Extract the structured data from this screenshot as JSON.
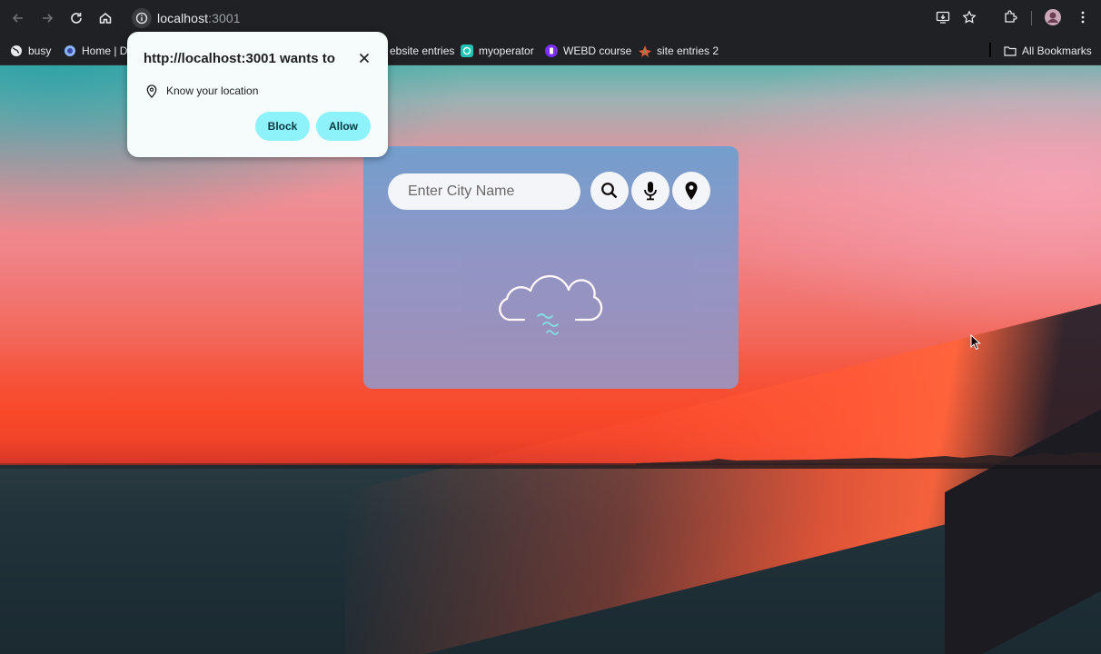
{
  "browser": {
    "url_host": "localhost",
    "url_port": ":3001",
    "bookmarks": [
      {
        "label": "busy",
        "icon": "globe-icon"
      },
      {
        "label": "Home | DD",
        "icon": "site-icon"
      },
      {
        "label": "ebsite entries",
        "icon": ""
      },
      {
        "label": "myoperator",
        "icon": "myoperator-icon"
      },
      {
        "label": "WEBD course",
        "icon": "webd-icon"
      },
      {
        "label": "site entries 2",
        "icon": "site-entries-icon"
      }
    ],
    "all_bookmarks_label": "All Bookmarks"
  },
  "permission_prompt": {
    "title": "http://localhost:3001 wants to",
    "permission": "Know your location",
    "block_label": "Block",
    "allow_label": "Allow"
  },
  "weather_app": {
    "search_placeholder": "Enter City Name",
    "search_value": ""
  },
  "colors": {
    "accent_button": "#8ef2fb",
    "card_top": "#6e9fd0",
    "card_bottom": "#9c92bd",
    "toolbar": "#202124"
  }
}
